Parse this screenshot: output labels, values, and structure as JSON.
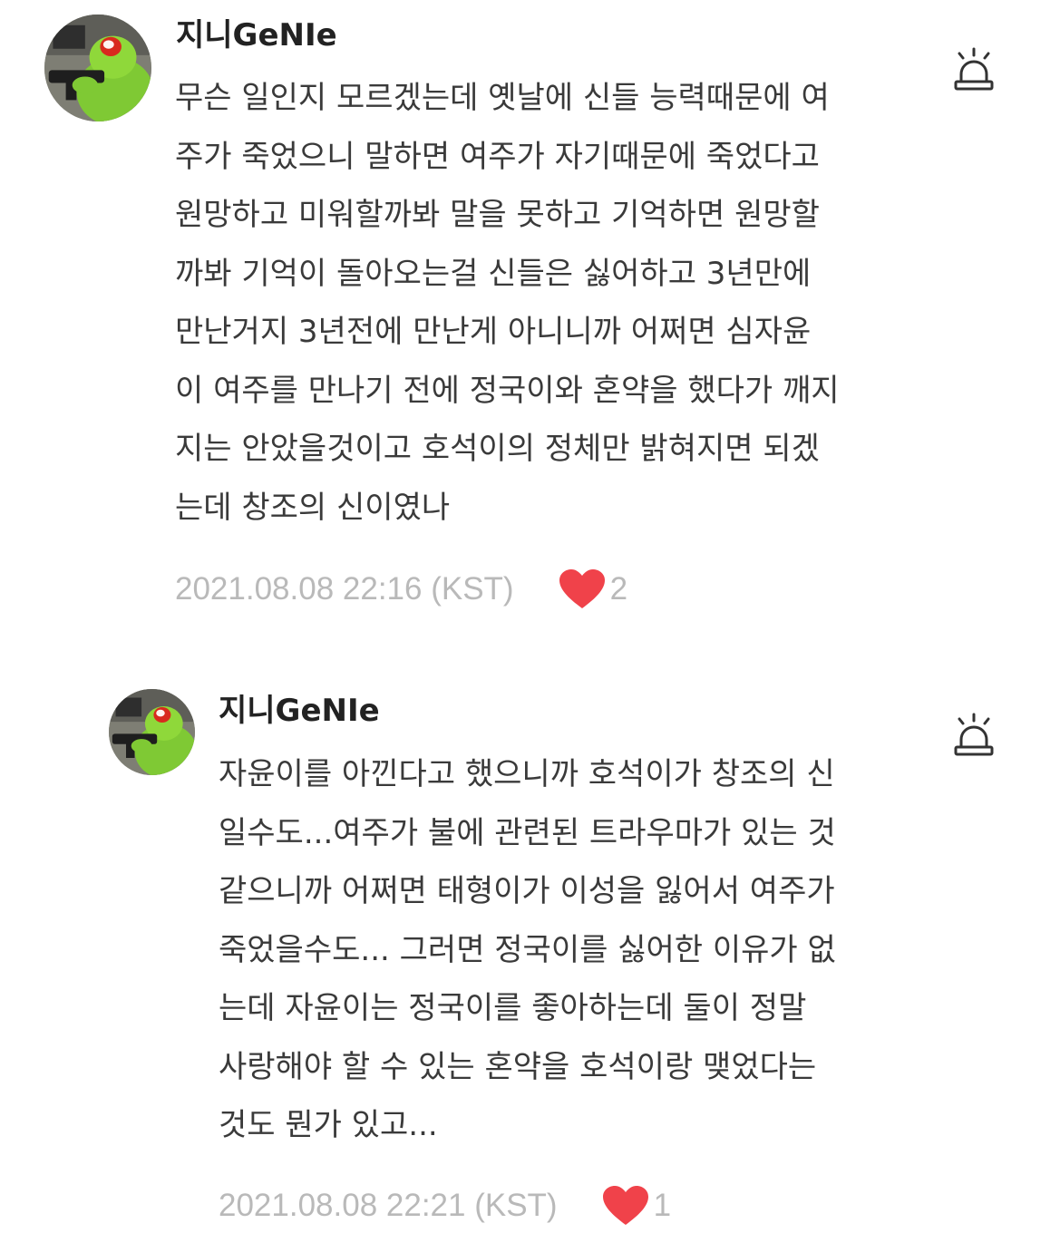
{
  "comments": [
    {
      "author": "지니GeNIe",
      "lines": [
        "무슨 일인지 모르겠는데 옛날에 신들 능력때문에 여",
        "주가 죽었으니 말하면 여주가 자기때문에 죽었다고",
        "원망하고 미워할까봐 말을 못하고 기억하면 원망할",
        "까봐 기억이 돌아오는걸 신들은 싫어하고 3년만에",
        "만난거지 3년전에 만난게 아니니까 어쩌면 심자윤",
        "이 여주를 만나기 전에 정국이와 혼약을 했다가 깨지",
        "지는 안았을것이고 호석이의 정체만 밝혀지면 되겠",
        "는데 창조의 신이였나"
      ],
      "timestamp": "2021.08.08 22:16 (KST)",
      "likes": "2",
      "icons": {
        "avatar": "kermit-avatar",
        "like": "heart-icon",
        "report": "siren-icon"
      }
    },
    {
      "author": "지니GeNIe",
      "lines": [
        "자윤이를 아낀다고 했으니까 호석이가 창조의 신",
        "일수도...여주가 불에 관련된 트라우마가 있는 것",
        "같으니까 어쩌면 태형이가 이성을 잃어서 여주가",
        "죽었을수도... 그러면 정국이를 싫어한 이유가 없",
        "는데 자윤이는 정국이를 좋아하는데 둘이 정말",
        "사랑해야 할 수 있는 혼약을 호석이랑 맺었다는",
        "것도 뭔가 있고..."
      ],
      "timestamp": "2021.08.08 22:21 (KST)",
      "likes": "1",
      "icons": {
        "avatar": "kermit-avatar",
        "like": "heart-icon",
        "report": "siren-icon"
      }
    }
  ],
  "colors": {
    "heart": "#f0424a",
    "timestamp": "#b9b9b9",
    "author": "#222222",
    "body": "#3a3a3a",
    "icon_stroke": "#333333"
  }
}
